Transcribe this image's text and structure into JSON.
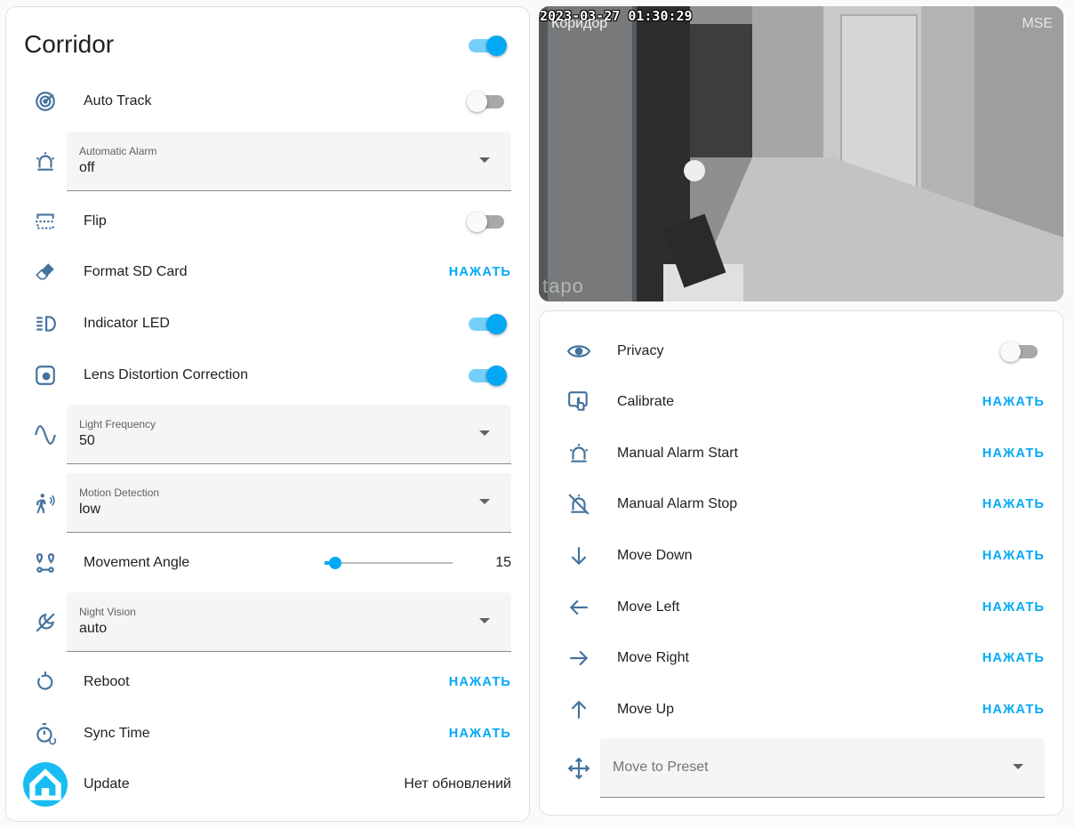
{
  "left_card": {
    "title": "Corridor",
    "title_toggle_on": true,
    "rows": {
      "auto_track": {
        "label": "Auto Track",
        "on": false,
        "icon": "radar-icon"
      },
      "automatic_alarm": {
        "label": "Automatic Alarm",
        "value": "off",
        "icon": "alarm-light-icon"
      },
      "flip": {
        "label": "Flip",
        "on": false,
        "icon": "flip-vertical-icon"
      },
      "format_sd": {
        "label": "Format SD Card",
        "action": "НАЖАТЬ",
        "icon": "eraser-icon"
      },
      "indicator_led": {
        "label": "Indicator LED",
        "on": true,
        "icon": "led-icon"
      },
      "lens_distortion": {
        "label": "Lens Distortion Correction",
        "on": true,
        "icon": "lens-icon"
      },
      "light_frequency": {
        "label": "Light Frequency",
        "value": "50",
        "icon": "sine-wave-icon"
      },
      "motion_detection": {
        "label": "Motion Detection",
        "value": "low",
        "icon": "motion-sensor-icon"
      },
      "movement_angle": {
        "label": "Movement Angle",
        "value": "15",
        "fraction": 0.08,
        "icon": "map-marker-distance-icon"
      },
      "night_vision": {
        "label": "Night Vision",
        "value": "auto",
        "icon": "weather-night-icon"
      },
      "reboot": {
        "label": "Reboot",
        "action": "НАЖАТЬ",
        "icon": "restart-icon"
      },
      "sync_time": {
        "label": "Sync Time",
        "action": "НАЖАТЬ",
        "icon": "timer-sync-icon"
      },
      "update": {
        "label": "Update",
        "state": "Нет обновлений",
        "icon": "home-assistant-logo-icon"
      }
    }
  },
  "camera": {
    "timestamp": "2023-03-27 01:30:29",
    "title": "Коридор",
    "badge": "MSE",
    "watermark": "tapo"
  },
  "right_card": {
    "rows": {
      "privacy": {
        "label": "Privacy",
        "on": false,
        "icon": "eye-icon"
      },
      "calibrate": {
        "label": "Calibrate",
        "action": "НАЖАТЬ",
        "icon": "gesture-tap-icon"
      },
      "alarm_start": {
        "label": "Manual Alarm Start",
        "action": "НАЖАТЬ",
        "icon": "alarm-light-icon"
      },
      "alarm_stop": {
        "label": "Manual Alarm Stop",
        "action": "НАЖАТЬ",
        "icon": "alarm-light-off-icon"
      },
      "move_down": {
        "label": "Move Down",
        "action": "НАЖАТЬ",
        "icon": "arrow-down-icon"
      },
      "move_left": {
        "label": "Move Left",
        "action": "НАЖАТЬ",
        "icon": "arrow-left-icon"
      },
      "move_right": {
        "label": "Move Right",
        "action": "НАЖАТЬ",
        "icon": "arrow-right-icon"
      },
      "move_up": {
        "label": "Move Up",
        "action": "НАЖАТЬ",
        "icon": "arrow-up-icon"
      },
      "move_to_preset": {
        "placeholder": "Move to Preset",
        "icon": "cursor-move-icon"
      }
    }
  },
  "colors": {
    "accent": "#03a9f4",
    "icon": "#44739e",
    "text": "#212121"
  }
}
